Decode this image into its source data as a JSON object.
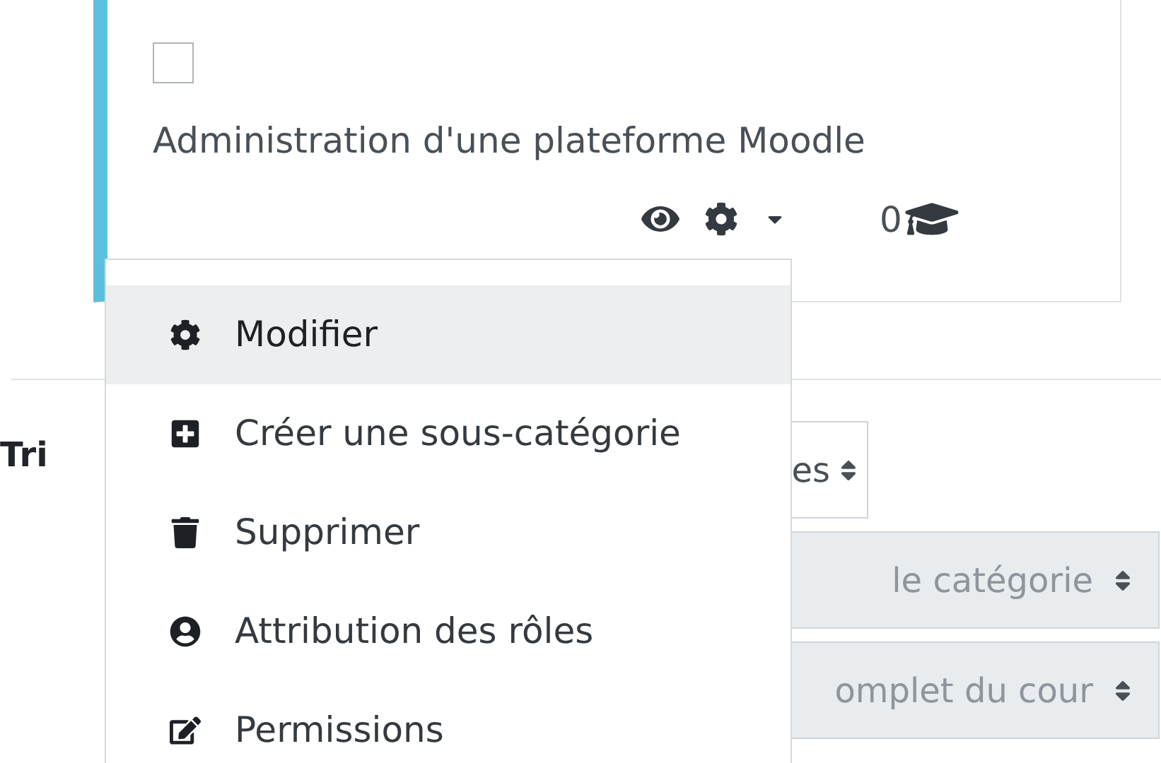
{
  "category": {
    "checked": false,
    "name": "Administration d'une plateforme Moodle",
    "course_count": "0"
  },
  "sort": {
    "label": "Tri",
    "selects": [
      {
        "value": "es",
        "disabled": false
      },
      {
        "value": "le catégorie",
        "disabled": true
      },
      {
        "value": "omplet du cour",
        "disabled": true
      }
    ]
  },
  "menu": {
    "items": [
      {
        "kind": "gear",
        "label": "Modifier",
        "selected": true
      },
      {
        "kind": "plus",
        "label": "Créer une sous-catégorie",
        "selected": false
      },
      {
        "kind": "trash",
        "label": "Supprimer",
        "selected": false
      },
      {
        "kind": "user",
        "label": "Attribution des rôles",
        "selected": false
      },
      {
        "kind": "edit",
        "label": "Permissions",
        "selected": false
      }
    ]
  }
}
